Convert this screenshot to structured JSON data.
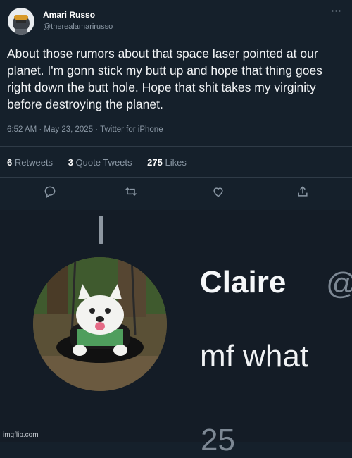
{
  "tweet": {
    "author_name": "Amari Russo",
    "author_handle": "@therealamarirusso",
    "more_icon": "⋯",
    "text": "About those rumors about that space laser pointed at our planet. I'm gonn stick my butt up and hope that thing goes right down the butt hole. Hope that shit takes my virginity before destroying the planet.",
    "meta": "6:52 AM · May 23, 2025 · Twitter for iPhone",
    "stats": {
      "retweets_count": "6",
      "retweets_label": "Retweets",
      "quotes_count": "3",
      "quotes_label": "Quote Tweets",
      "likes_count": "275",
      "likes_label": "Likes"
    },
    "actions": [
      "reply-icon",
      "retweet-icon",
      "like-icon",
      "share-icon"
    ]
  },
  "meme": {
    "name": "Claire",
    "handle_fragment": "@",
    "reply_text": "mf what",
    "reply_count_fragment": "25"
  },
  "watermark": "imgflip.com",
  "colors": {
    "background": "#15202b",
    "secondary_text": "#8b98a5",
    "divider": "#2f3b47"
  }
}
